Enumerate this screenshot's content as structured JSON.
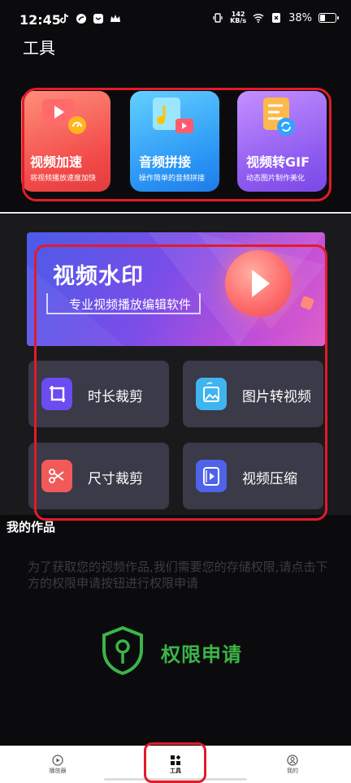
{
  "status_bar": {
    "time": "12:45",
    "speed_value": "142",
    "speed_unit": "KB/s",
    "battery": "38%",
    "battery_level": 0.38
  },
  "page": {
    "title": "工具"
  },
  "feature_cards": [
    {
      "title": "视频加速",
      "subtitle": "将视频播放速度加快"
    },
    {
      "title": "音频拼接",
      "subtitle": "操作简单的音频拼接"
    },
    {
      "title": "视频转GIF",
      "subtitle": "动态图片制作美化"
    }
  ],
  "banner": {
    "title": "视频水印",
    "subtitle": "专业视频播放编辑软件"
  },
  "tools": [
    {
      "label": "时长裁剪",
      "color": "#6a4cf0"
    },
    {
      "label": "图片转视频",
      "color": "#3fb5f0"
    },
    {
      "label": "尺寸裁剪",
      "color": "#f25a5a"
    },
    {
      "label": "视频压缩",
      "color": "#4f63e8"
    }
  ],
  "works": {
    "title": "我的作品",
    "permission_text": "为了获取您的视频作品,我们需要您的存储权限,请点击下方的权限申请按钮进行权限申请",
    "permission_button": "权限申请"
  },
  "nav": [
    {
      "label": "播放器",
      "icon": "play-circle-icon"
    },
    {
      "label": "工具",
      "icon": "grid-icon"
    },
    {
      "label": "我的",
      "icon": "user-icon"
    }
  ],
  "colors": {
    "highlight": "#e21b2a",
    "green": "#3bb548"
  }
}
